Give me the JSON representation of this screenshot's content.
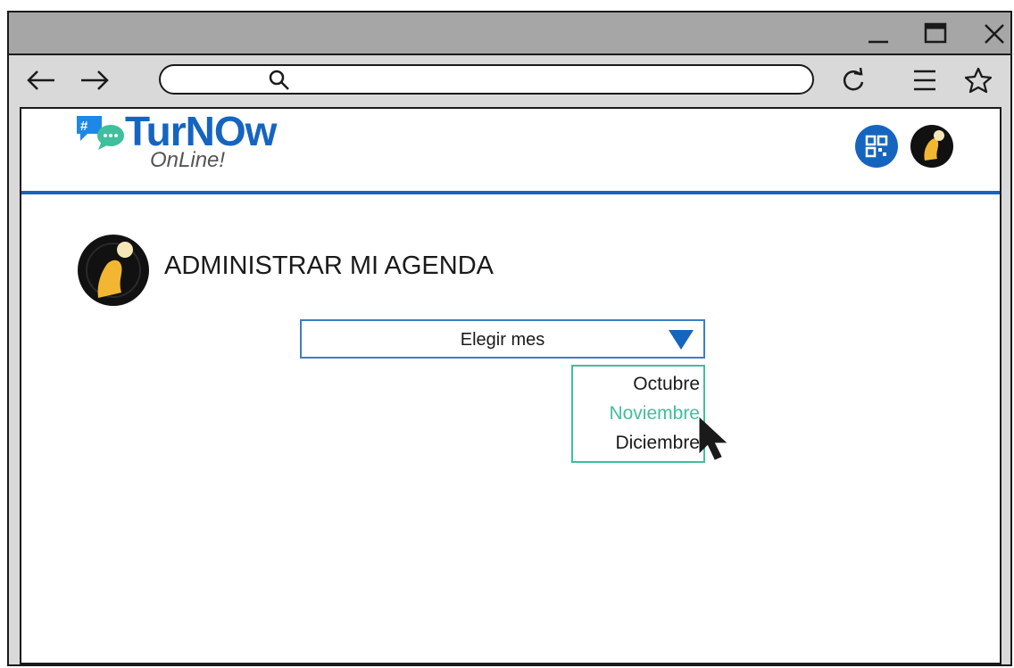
{
  "browser": {
    "title_controls": {
      "minimize": "minimize-icon",
      "maximize": "maximize-icon",
      "close": "close-icon"
    },
    "nav": {
      "back": "back-arrow-icon",
      "forward": "forward-arrow-icon",
      "reload": "reload-icon",
      "menu": "hamburger-icon",
      "bookmark": "star-icon"
    },
    "address": {
      "value": "",
      "placeholder": ""
    }
  },
  "app": {
    "logo": {
      "word": "TurNOw",
      "sub": "OnLine!"
    },
    "header_icons": [
      "qr-code-icon",
      "user-avatar"
    ]
  },
  "page": {
    "title": "ADMINISTRAR MI AGENDA"
  },
  "month_select": {
    "label": "Elegir mes",
    "options": [
      "Octubre",
      "Noviembre",
      "Diciembre"
    ],
    "hovered_index": 1
  },
  "colors": {
    "brand": "#1565c0",
    "select_border": "#3d7ec7",
    "dropdown_border": "#3fbf9c",
    "hover_text": "#3fbf9c"
  }
}
